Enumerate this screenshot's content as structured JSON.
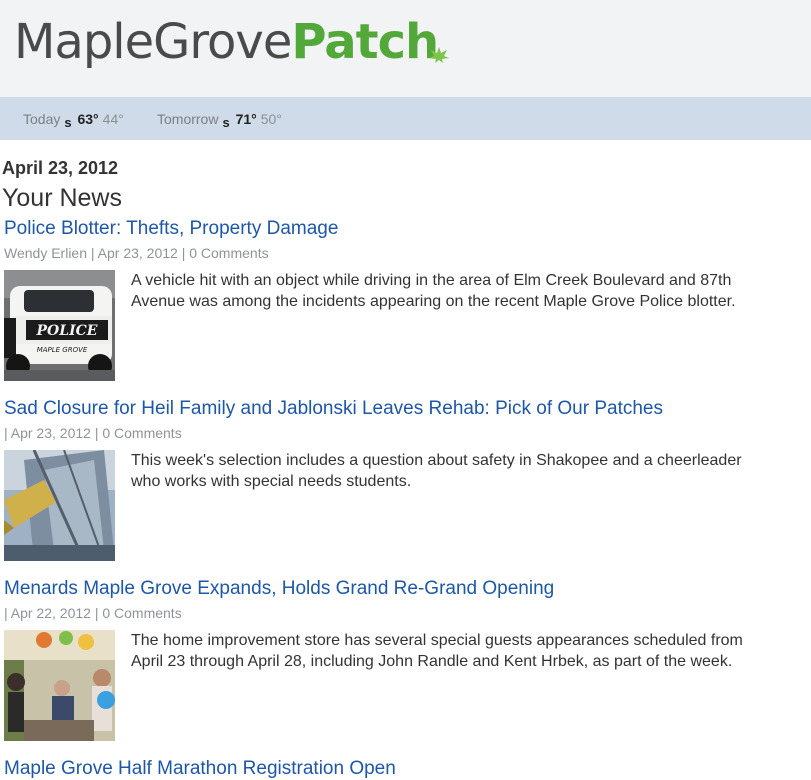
{
  "header": {
    "logo_town": "MapleGrove",
    "logo_brand": "Patch"
  },
  "weather": {
    "today": {
      "label": "Today",
      "cond": "s",
      "high": "63°",
      "low": "44°"
    },
    "tomorrow": {
      "label": "Tomorrow",
      "cond": "s",
      "high": "71°",
      "low": "50°"
    }
  },
  "page": {
    "date": "April 23, 2012",
    "section_title": "Your News"
  },
  "articles": [
    {
      "title": "Police Blotter: Thefts, Property Damage",
      "meta": "Wendy Erlien | Apr 23, 2012 | 0 Comments",
      "summary": "A vehicle hit with an object while driving in the area of Elm Creek Boulevard and 87th Avenue was among the incidents appearing on the recent Maple Grove Police blotter.",
      "thumb_text": "POLICE",
      "thumb_subtext": "MAPLE GROVE"
    },
    {
      "title": "Sad Closure for Heil Family and Jablonski Leaves Rehab: Pick of Our Patches",
      "meta": "| Apr 23, 2012 | 0 Comments",
      "summary": "This week's selection includes a question about safety in Shakopee and a cheerleader who works with special needs students."
    },
    {
      "title": "Menards Maple Grove Expands, Holds Grand Re-Grand Opening",
      "meta": "| Apr 22, 2012 | 0 Comments",
      "summary": "The home improvement store has several special guests appearances scheduled from April 23 through April 28, including John Randle and Kent Hrbek, as part of the week."
    },
    {
      "title": "Maple Grove Half Marathon Registration Open"
    }
  ],
  "colors": {
    "brand_green": "#53a83a",
    "link_blue": "#1d57a8",
    "weather_bar": "#cfdbe8"
  }
}
